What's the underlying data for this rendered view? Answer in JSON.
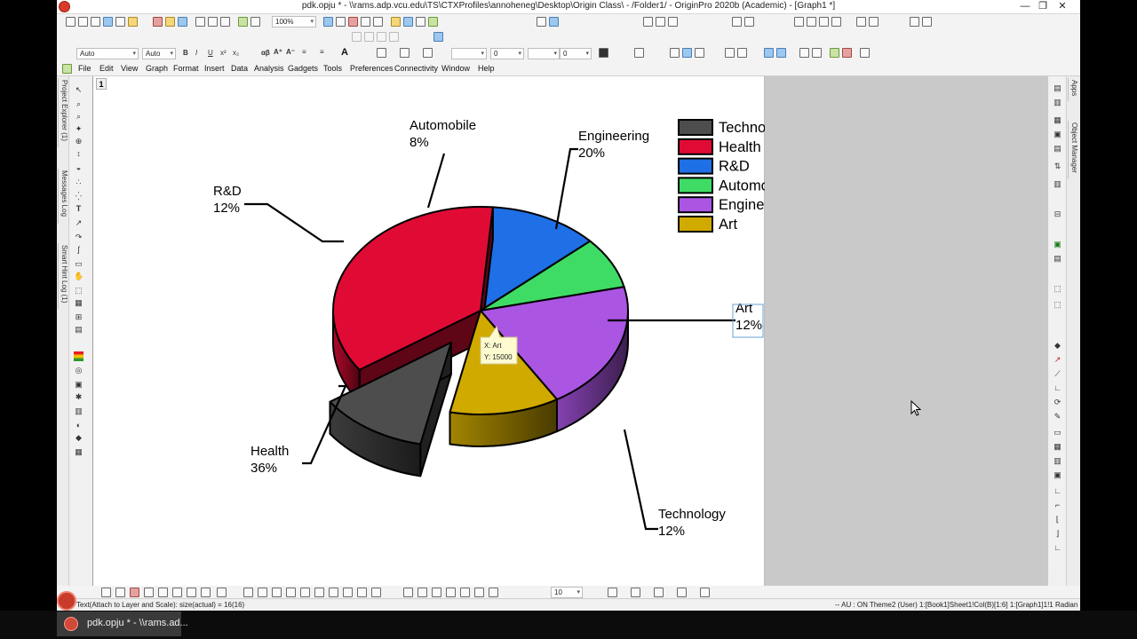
{
  "window": {
    "title": "pdk.opju * - \\\\rams.adp.vcu.edu\\TS\\CTXProfiles\\annoheneg\\Desktop\\Origin Class\\ - /Folder1/ - OriginPro 2020b (Academic) - [Graph1 *]",
    "minimize": "—",
    "maximize": "❐",
    "close": "✕"
  },
  "toolbar": {
    "zoom_value": "100%",
    "font_name": "Auto",
    "font_size": "Auto",
    "line_width_value": "0",
    "pattern_value": "0",
    "bottom_size": "10"
  },
  "menu": {
    "items": [
      "File",
      "Edit",
      "View",
      "Graph",
      "Format",
      "Insert",
      "Data",
      "Analysis",
      "Gadgets",
      "Tools",
      "Preferences",
      "Connectivity",
      "Window",
      "Help"
    ]
  },
  "left_dock": {
    "tabs": [
      "Project Explorer (1)",
      "Messages Log",
      "Smart Hint Log (1)"
    ]
  },
  "right_dock": {
    "tabs": [
      "Apps",
      "Object Manager"
    ]
  },
  "graph": {
    "layer_number": "1"
  },
  "chart_data": {
    "type": "pie",
    "style": "3d-exploded",
    "slices": [
      {
        "label": "Technology",
        "percent": "12%",
        "value": 12,
        "color": "#4d4d4d",
        "exploded": true
      },
      {
        "label": "Health",
        "percent": "36%",
        "value": 36,
        "color": "#e00b35",
        "exploded": false
      },
      {
        "label": "R&D",
        "percent": "12%",
        "value": 12,
        "color": "#1f6fe6",
        "exploded": false
      },
      {
        "label": "Automobile",
        "percent": "8%",
        "value": 8,
        "color": "#3fdc65",
        "exploded": false
      },
      {
        "label": "Engineering",
        "percent": "20%",
        "value": 20,
        "color": "#ab55e3",
        "exploded": false
      },
      {
        "label": "Art",
        "percent": "12%",
        "value": 12,
        "color": "#d1aa00",
        "exploded": false
      }
    ],
    "legend": {
      "placement": "top-right",
      "entries": [
        "Technology",
        "Health",
        "R&D",
        "Automobile",
        "Engineering",
        "Art"
      ]
    },
    "tooltip": {
      "x_line": "X: Art",
      "y_line": "Y: 15000"
    }
  },
  "status": {
    "left": "Text(Attach to Layer and Scale): size(actual) = 16(16)",
    "right": "--   AU : ON  Theme2 (User)  1:[Book1]Sheet1!Col(B)[1:6]  1:[Graph1]1!1  Radian"
  },
  "taskbar": {
    "item_label": "pdk.opju * - \\\\rams.ad..."
  }
}
